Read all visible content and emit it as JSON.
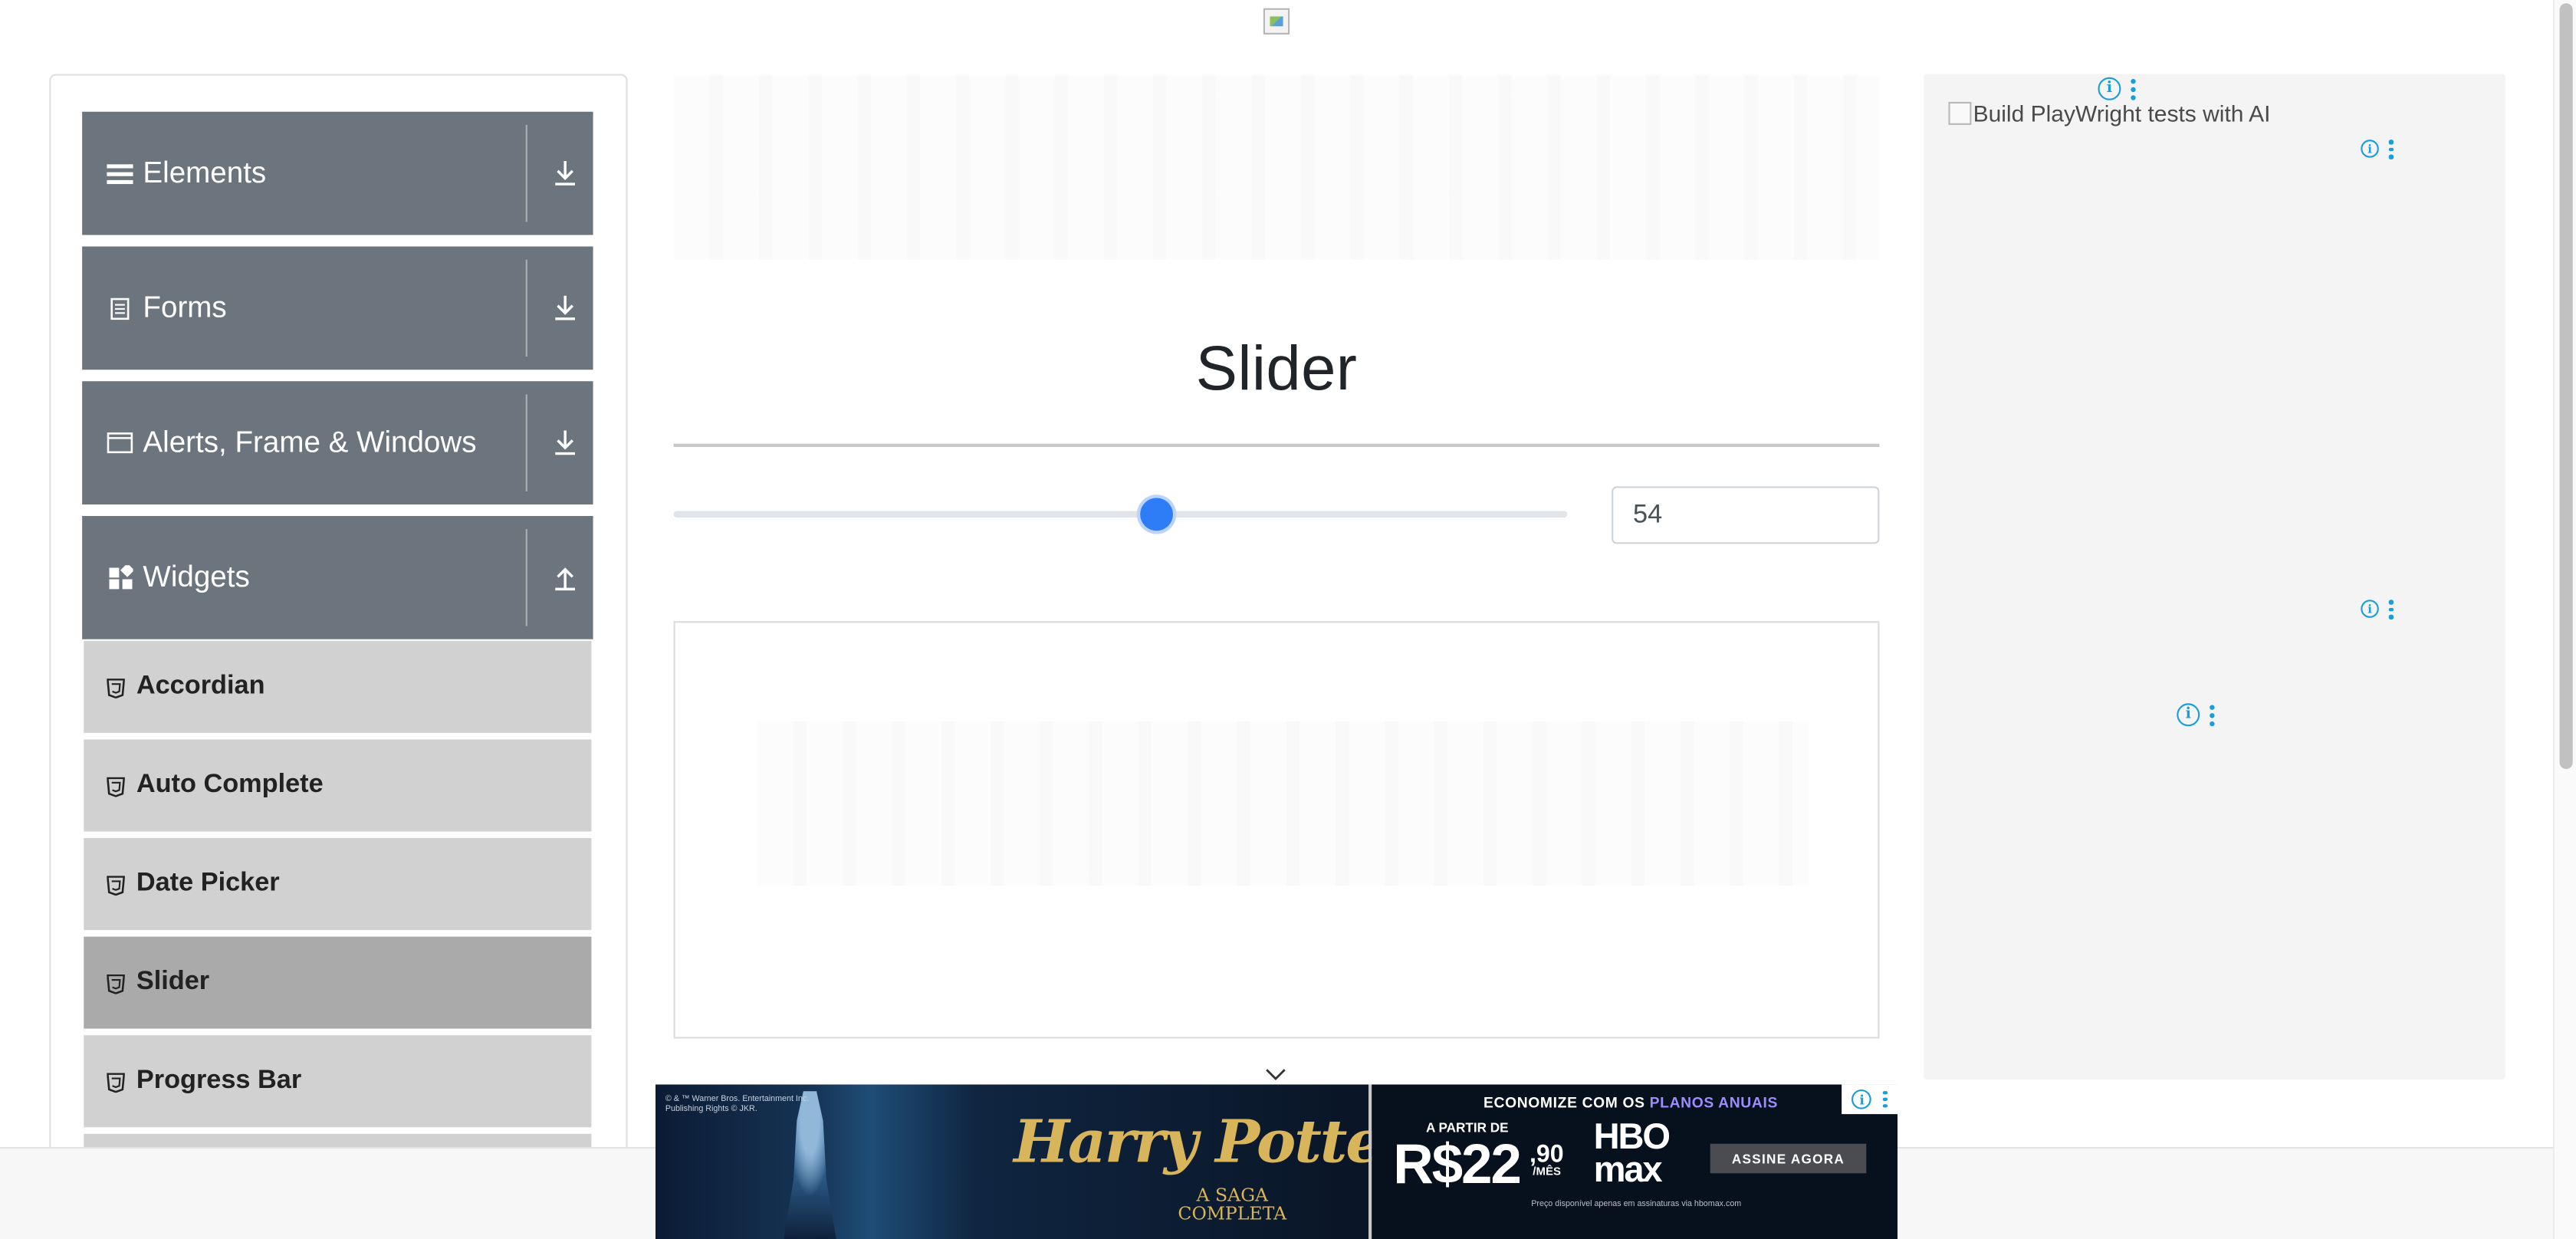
{
  "sidebar": {
    "groups": [
      {
        "label": "Elements",
        "icon": "hamburger-icon",
        "arrow": "download-arrow-icon"
      },
      {
        "label": "Forms",
        "icon": "document-icon",
        "arrow": "download-arrow-icon"
      },
      {
        "label": "Alerts, Frame & Windows",
        "icon": "window-icon",
        "arrow": "download-arrow-icon"
      },
      {
        "label": "Widgets",
        "icon": "widgets-icon",
        "arrow": "upload-arrow-icon"
      }
    ],
    "widget_items": [
      {
        "label": "Accordian",
        "active": false
      },
      {
        "label": "Auto Complete",
        "active": false
      },
      {
        "label": "Date Picker",
        "active": false
      },
      {
        "label": "Slider",
        "active": true
      },
      {
        "label": "Progress Bar",
        "active": false
      }
    ]
  },
  "main": {
    "title": "Slider",
    "slider": {
      "value": 54,
      "min": 0,
      "max": 100,
      "display": "54"
    }
  },
  "right_ad": {
    "broken_image_alt": "Build PlayWright tests with AI"
  },
  "banner": {
    "left_title": "Harry Potter",
    "left_subtitle": "A SAGA\nCOMPLETA",
    "legal": "© & ™ Warner Bros. Entertainment Inc. Publishing Rights © JKR.",
    "headline_prefix": "ECONOMIZE COM OS ",
    "headline_plan": "PLANOS ANUAIS",
    "from_label": "A PARTIR DE",
    "price_main": "R$22",
    "price_cents": ",90",
    "price_period": "/MÊS",
    "brand": "HBO\nmax",
    "cta": "ASSINE AGORA",
    "fine_print": "Preço disponível apenas em assinaturas via hbomax.com"
  },
  "colors": {
    "nav_header": "#6c757d",
    "nav_item": "#d1d1d1",
    "nav_item_active": "#aaaaaa",
    "slider_thumb": "#2f7df6",
    "adchoices": "#1a9dd9"
  }
}
